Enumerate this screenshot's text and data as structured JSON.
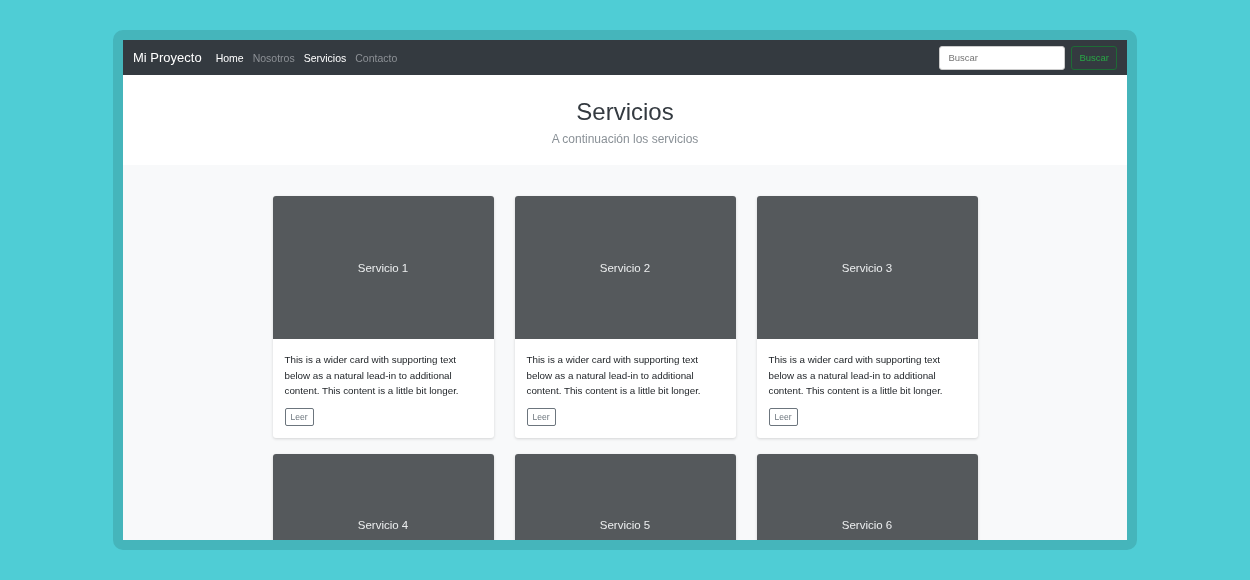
{
  "navbar": {
    "brand": "Mi Proyecto",
    "links": [
      {
        "label": "Home",
        "selected": true
      },
      {
        "label": "Nosotros",
        "selected": false
      },
      {
        "label": "Servicios",
        "selected": true
      },
      {
        "label": "Contacto",
        "selected": false
      }
    ],
    "search": {
      "placeholder": "Buscar"
    },
    "search_button": "Buscar"
  },
  "header": {
    "title": "Servicios",
    "subtitle": "A continuación los servicios"
  },
  "cards": [
    {
      "image_label": "Servicio 1",
      "text": "This is a wider card with supporting text below as a natural lead-in to additional content. This content is a little bit longer.",
      "button": "Leer"
    },
    {
      "image_label": "Servicio 2",
      "text": "This is a wider card with supporting text below as a natural lead-in to additional content. This content is a little bit longer.",
      "button": "Leer"
    },
    {
      "image_label": "Servicio 3",
      "text": "This is a wider card with supporting text below as a natural lead-in to additional content. This content is a little bit longer.",
      "button": "Leer"
    },
    {
      "image_label": "Servicio 4"
    },
    {
      "image_label": "Servicio 5"
    },
    {
      "image_label": "Servicio 6"
    }
  ]
}
